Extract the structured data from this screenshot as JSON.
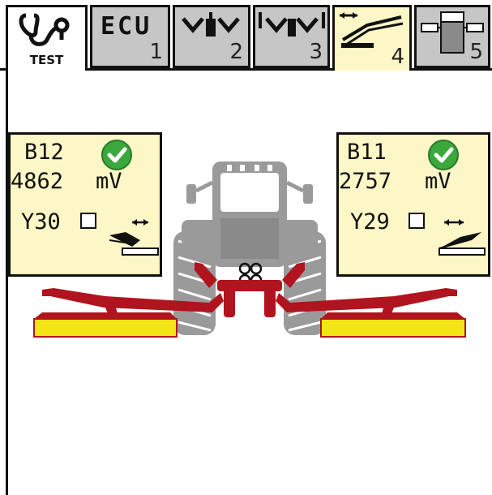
{
  "tabs": [
    {
      "id": "test",
      "label": "TEST",
      "icon": "diagnosis-icon",
      "active": false
    },
    {
      "id": "ecu",
      "label": "ECU",
      "number": "1",
      "icon": "ecu-text",
      "active": false
    },
    {
      "id": "tab2",
      "number": "2",
      "icon": "front-lift-icon",
      "active": false
    },
    {
      "id": "tab3",
      "number": "3",
      "icon": "side-lift-icon",
      "active": false
    },
    {
      "id": "tab4",
      "number": "4",
      "icon": "side-shift-icon",
      "active": true
    },
    {
      "id": "tab5",
      "number": "5",
      "icon": "terminal-layout-icon",
      "active": false
    }
  ],
  "left_panel": {
    "sensor": "B12",
    "sensor_ok": true,
    "voltage": "4862",
    "unit": "mV",
    "valve": "Y30",
    "valve_checked": false,
    "icon": "arm-retract-icon"
  },
  "right_panel": {
    "sensor": "B11",
    "sensor_ok": true,
    "voltage": "2757",
    "unit": "mV",
    "valve": "Y29",
    "valve_checked": false,
    "icon": "arm-retract-icon"
  },
  "colors": {
    "panel_bg": "#fdf6c6",
    "active_tab_bg": "#fdf6c6",
    "tab_bg": "#c6c6c6",
    "ok_green": "#3aa83a",
    "mower_frame": "#b0141e",
    "mower_deck": "#f4e516",
    "tractor_gray": "#9a9a9a"
  }
}
